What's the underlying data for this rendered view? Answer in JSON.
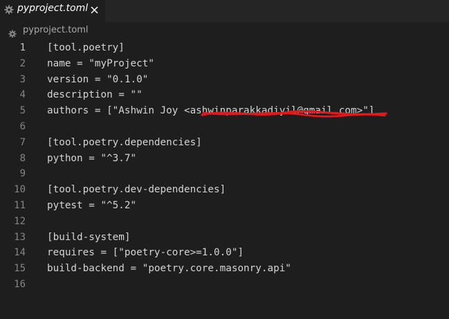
{
  "tab": {
    "title": "pyproject.toml",
    "close_glyph": "✕"
  },
  "breadcrumb": {
    "label": "pyproject.toml",
    "icon": "gear-icon"
  },
  "editor": {
    "line_numbers": [
      "1",
      "2",
      "3",
      "4",
      "5",
      "6",
      "7",
      "8",
      "9",
      "10",
      "11",
      "12",
      "13",
      "14",
      "15",
      "16"
    ],
    "lines": [
      "[tool.poetry]",
      "name = \"myProject\"",
      "version = \"0.1.0\"",
      "description = \"\"",
      "authors = [\"Ashwin Joy <ashwinparakkadiyil@gmail.com>\"]",
      "",
      "[tool.poetry.dependencies]",
      "python = \"^3.7\"",
      "",
      "[tool.poetry.dev-dependencies]",
      "pytest = \"^5.2\"",
      "",
      "[build-system]",
      "requires = [\"poetry-core>=1.0.0\"]",
      "build-backend = \"poetry.core.masonry.api\"",
      ""
    ],
    "current_line": "1"
  },
  "colors": {
    "background": "#1e1e1e",
    "tabbar": "#252526",
    "text": "#d4d4d4",
    "line_number": "#858585",
    "redaction": "#e0191e"
  }
}
